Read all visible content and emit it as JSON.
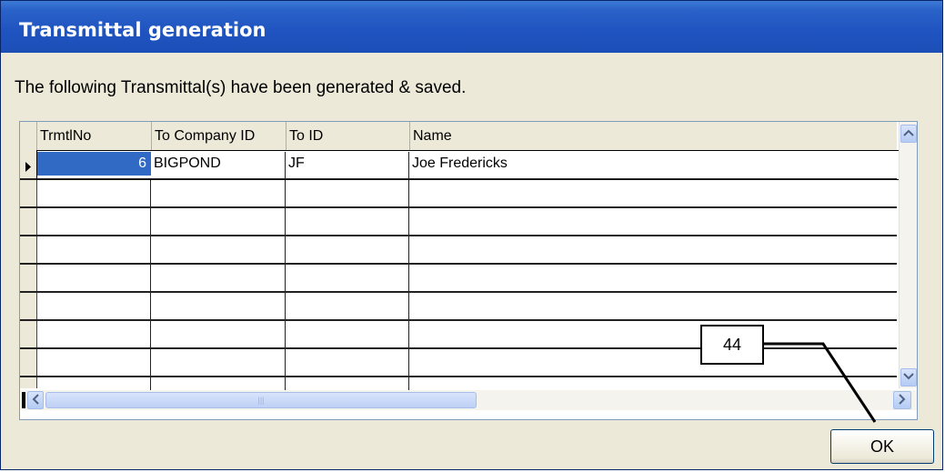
{
  "window": {
    "title": "Transmittal generation"
  },
  "message": "The following Transmittal(s) have been generated & saved.",
  "grid": {
    "columns": [
      "TrmtlNo",
      "To Company ID",
      "To ID",
      "Name"
    ],
    "rows": [
      {
        "trmtlno": "6",
        "company": "BIGPOND",
        "to_id": "JF",
        "name": "Joe Fredericks"
      }
    ],
    "empty_rows": 7
  },
  "buttons": {
    "ok_label": "OK"
  },
  "annotation": {
    "callout_number": "44"
  },
  "colors": {
    "titlebar": "#1f53c0",
    "selection": "#316ac5",
    "dialog_bg": "#ece9d8"
  },
  "icons": [
    "row-pointer-icon",
    "scroll-up-icon",
    "scroll-down-icon",
    "scroll-left-icon",
    "scroll-right-icon",
    "scroll-grip-icon"
  ]
}
